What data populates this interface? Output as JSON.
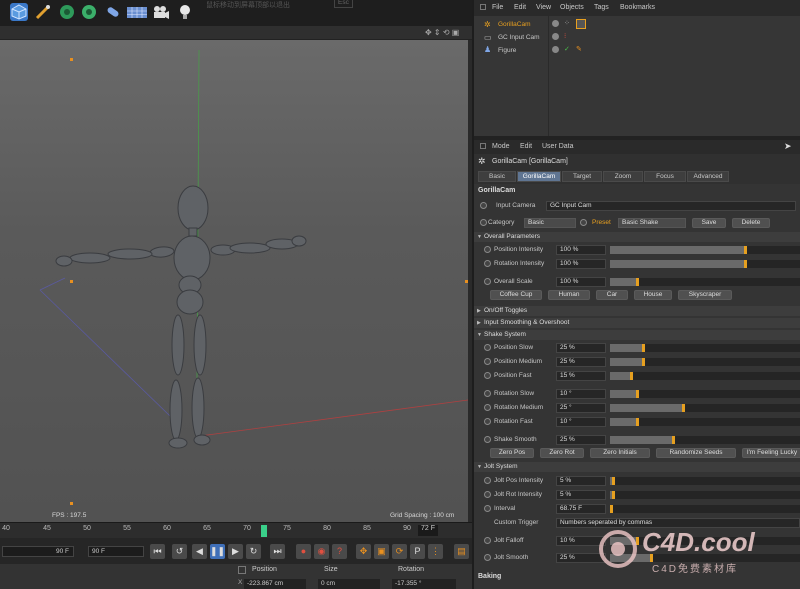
{
  "toolbar": {
    "icons": [
      "cube-icon",
      "pen-icon",
      "gear-icon",
      "gear-icon",
      "capsule-icon",
      "grid-icon",
      "camera-icon",
      "light-bulb-icon"
    ],
    "overlay_text": "鼠标移动到屏幕顶部以退出",
    "overlay_key": "Esc"
  },
  "viewport": {
    "fps": "FPS : 197.5",
    "grid_spacing": "Grid Spacing : 100 cm"
  },
  "timeline": {
    "ticks": [
      "40",
      "45",
      "50",
      "55",
      "60",
      "65",
      "70",
      "75",
      "80",
      "85",
      "90"
    ],
    "end_label": "72 F"
  },
  "transport": {
    "frame_start": "90 F",
    "frame_end": "90 F"
  },
  "coords": {
    "position_label": "Position",
    "size_label": "Size",
    "rotation_label": "Rotation",
    "x_position": "-223.867 cm",
    "x_size": "0 cm",
    "x_rotation": "-17.355 °",
    "x_prefix": "X"
  },
  "object_manager": {
    "menu": [
      "File",
      "Edit",
      "View",
      "Objects",
      "Tags",
      "Bookmarks"
    ],
    "objects": [
      {
        "name": "GorillaCam",
        "color": "#e8a020"
      },
      {
        "name": "GC Input Cam",
        "color": "#d0d0d0"
      },
      {
        "name": "Figure",
        "color": "#d0d0d0"
      }
    ]
  },
  "attribute_manager": {
    "menu": [
      "Mode",
      "Edit",
      "User Data"
    ],
    "title": "GorillaCam [GorillaCam]",
    "tabs": [
      "Basic",
      "GorillaCam",
      "Target",
      "Zoom",
      "Focus",
      "Advanced"
    ],
    "active_tab": "GorillaCam",
    "section_title": "GorillaCam",
    "input_camera_label": "Input Camera",
    "input_camera_value": "GC Input Cam",
    "category_label": "Category",
    "category_value": "Basic",
    "preset_label": "Preset",
    "preset_value": "Basic Shake",
    "save_label": "Save",
    "delete_label": "Delete",
    "overall_parameters": "Overall Parameters",
    "position_intensity_label": "Position Intensity",
    "position_intensity_value": "100 %",
    "rotation_intensity_label": "Rotation Intensity",
    "rotation_intensity_value": "100 %",
    "overall_scale_label": "Overall Scale",
    "overall_scale_value": "100 %",
    "scale_buttons": [
      "Coffee Cup",
      "Human",
      "Car",
      "House",
      "Skyscraper"
    ],
    "onoff_toggles": "On/Off Toggles",
    "input_smoothing": "Input Smoothing & Overshoot",
    "shake_system": "Shake System",
    "shake_params": [
      {
        "label": "Position Slow",
        "value": "25 %",
        "fill": 0.25
      },
      {
        "label": "Position Medium",
        "value": "25 %",
        "fill": 0.25
      },
      {
        "label": "Position Fast",
        "value": "15 %",
        "fill": 0.15
      },
      {
        "label": "Rotation Slow",
        "value": "10 °",
        "fill": 0.2
      },
      {
        "label": "Rotation Medium",
        "value": "25 °",
        "fill": 0.5
      },
      {
        "label": "Rotation Fast",
        "value": "10 °",
        "fill": 0.2
      },
      {
        "label": "Shake Smooth",
        "value": "25 %",
        "fill": 0.45
      }
    ],
    "shake_buttons": [
      "Zero Pos",
      "Zero Rot",
      "Zero Initials",
      "Randomize Seeds",
      "I'm Feeling Lucky"
    ],
    "jolt_system": "Jolt System",
    "jolt_pos_label": "Jolt Pos Intensity",
    "jolt_pos_value": "5 %",
    "jolt_rot_label": "Jolt Rot Intensity",
    "jolt_rot_value": "5 %",
    "interval_label": "Interval",
    "interval_value": "68.75 F",
    "custom_trigger_label": "Custom Trigger",
    "custom_trigger_value": "Numbers seperated by commas",
    "jolt_falloff_label": "Jolt Falloff",
    "jolt_falloff_value": "10 %",
    "jolt_smooth_label": "Jolt Smooth",
    "jolt_smooth_value": "25 %",
    "baking": "Baking"
  },
  "watermark": {
    "brand": "C4D.cool",
    "subtitle": "C4D免费素材库"
  }
}
